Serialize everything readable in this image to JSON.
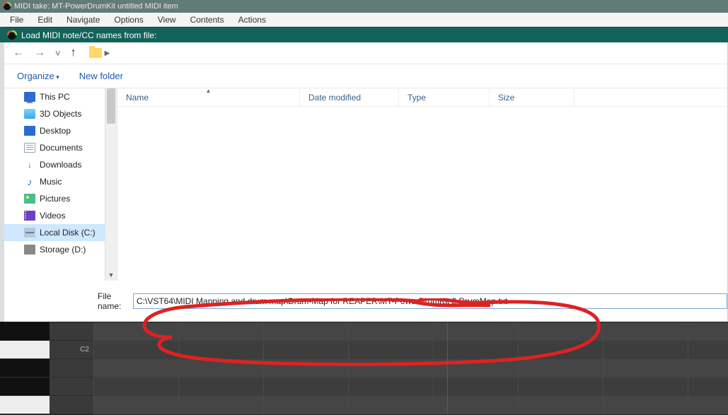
{
  "window": {
    "title": "MIDI take: MT-PowerDrumKit untitled MIDI item"
  },
  "menu": {
    "file": "File",
    "edit": "Edit",
    "navigate": "Navigate",
    "options": "Options",
    "view": "View",
    "contents": "Contents",
    "actions": "Actions"
  },
  "dialog": {
    "title": "Load MIDI note/CC names from file:"
  },
  "toolbar": {
    "organize": "Organize",
    "new_folder": "New folder"
  },
  "columns": {
    "name": "Name",
    "date": "Date modified",
    "type": "Type",
    "size": "Size"
  },
  "tree": {
    "items": [
      {
        "label": "This PC",
        "icon": "pc",
        "selected": false
      },
      {
        "label": "3D Objects",
        "icon": "cube",
        "selected": false
      },
      {
        "label": "Desktop",
        "icon": "desk",
        "selected": false
      },
      {
        "label": "Documents",
        "icon": "doc",
        "selected": false
      },
      {
        "label": "Downloads",
        "icon": "dl",
        "selected": false
      },
      {
        "label": "Music",
        "icon": "music",
        "selected": false
      },
      {
        "label": "Pictures",
        "icon": "pic",
        "selected": false
      },
      {
        "label": "Videos",
        "icon": "video",
        "selected": false
      },
      {
        "label": "Local Disk (C:)",
        "icon": "disk",
        "selected": true
      },
      {
        "label": "Storage (D:)",
        "icon": "storage",
        "selected": false
      }
    ]
  },
  "file_name": {
    "label": "File name:",
    "value": "C:\\VST64\\MIDI Mapping and drum map\\Drum-Map for REAPER\\MT-PowerDrumKit 2 DrumMap.txt"
  },
  "piano": {
    "c2_label": "C2"
  }
}
